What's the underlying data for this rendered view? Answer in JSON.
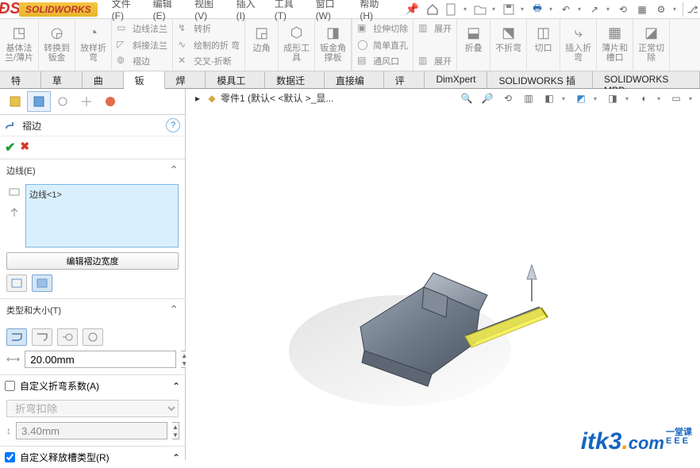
{
  "brand": {
    "name": "SOLIDWORKS"
  },
  "menu": {
    "file": "文件(F)",
    "edit": "编辑(E)",
    "view": "视图(V)",
    "insert": "插入(I)",
    "tool": "工具(T)",
    "window": "窗口(W)",
    "help": "帮助(H)"
  },
  "ribbon": {
    "baseflange": "基体法\n兰/薄片",
    "convert": "转换到\n钣金",
    "loftbend": "放样折\n弯",
    "edgeflange": "边线法兰",
    "miterflange": "斜接法兰",
    "hem": "褶边",
    "jog": "转折",
    "sketchedBend": "绘制的折\n弯",
    "crossbreak": "交叉-折断",
    "corner": "边角",
    "formingTool": "成形工\n具",
    "sheetGusset": "钣金角\n撑板",
    "ventilate": "通风口",
    "extrudedCut": "拉伸切除",
    "simpleHole": "简单直孔",
    "unfold1": "展开",
    "unfold2": "展开",
    "fold": "折叠",
    "nofold": "不折弯",
    "cut": "切口",
    "insertBend": "插入折\n弯",
    "flatAndBreak": "薄片和\n槽口",
    "normalCut": "正常切\n除"
  },
  "tabs": [
    "特征",
    "草图",
    "曲面",
    "钣金",
    "焊件",
    "模具工具",
    "数据迁移",
    "直接编辑",
    "评估",
    "DimXpert",
    "SOLIDWORKS 插件",
    "SOLIDWORKS MBD"
  ],
  "activeTab": "钣金",
  "breadcrumb": "零件1  (默认< <默认 >_显...",
  "pm": {
    "featureName": "褶边",
    "edgesHeader": "边线(E)",
    "selectedEdge": "边线<1>",
    "editWidthBtn": "编辑褶边宽度",
    "typeHeader": "类型和大小(T)",
    "dim1": "20.00mm",
    "customBendHeader": "自定义折弯系数(A)",
    "bendDeduction": "折弯扣除",
    "bendVal": "3.40mm",
    "customReliefHeader": "自定义释放槽类型(R)"
  },
  "watermark": {
    "a": "itk3",
    "b": ".",
    "c": "com",
    "d1": "一堂课",
    "d2": "EEE"
  }
}
